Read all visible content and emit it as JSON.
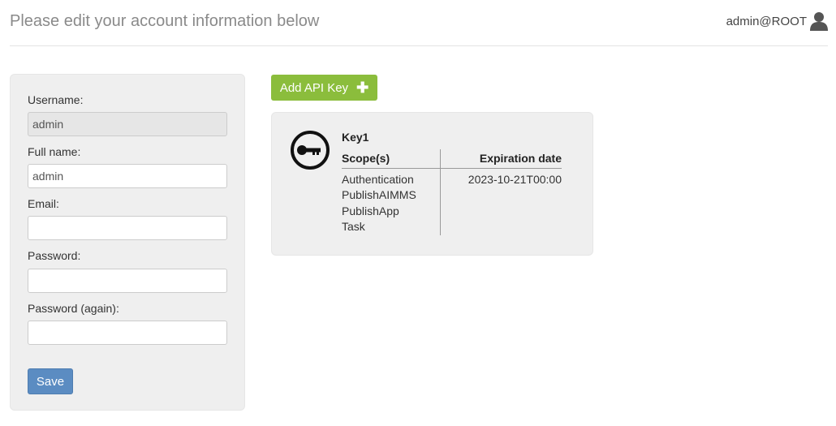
{
  "header": {
    "title": "Please edit your account information below",
    "user": "admin@ROOT",
    "user_icon": "user-icon"
  },
  "form": {
    "username_label": "Username:",
    "username_value": "admin",
    "fullname_label": "Full name:",
    "fullname_value": "admin",
    "email_label": "Email:",
    "email_value": "",
    "password_label": "Password:",
    "password_value": "",
    "password_again_label": "Password (again):",
    "password_again_value": "",
    "save_label": "Save"
  },
  "api_keys": {
    "add_label": "Add API Key",
    "add_icon": "plus-icon",
    "accent_color": "#8bbd3c",
    "keys": [
      {
        "name": "Key1",
        "icon": "key-icon",
        "scope_header": "Scope(s)",
        "expiration_header": "Expiration date",
        "scopes": [
          "Authentication",
          "PublishAIMMS",
          "PublishApp",
          "Task"
        ],
        "expiration": "2023-10-21T00:00"
      }
    ]
  },
  "colors": {
    "save_button": "#5b8cc2",
    "panel_bg": "#efefef"
  }
}
